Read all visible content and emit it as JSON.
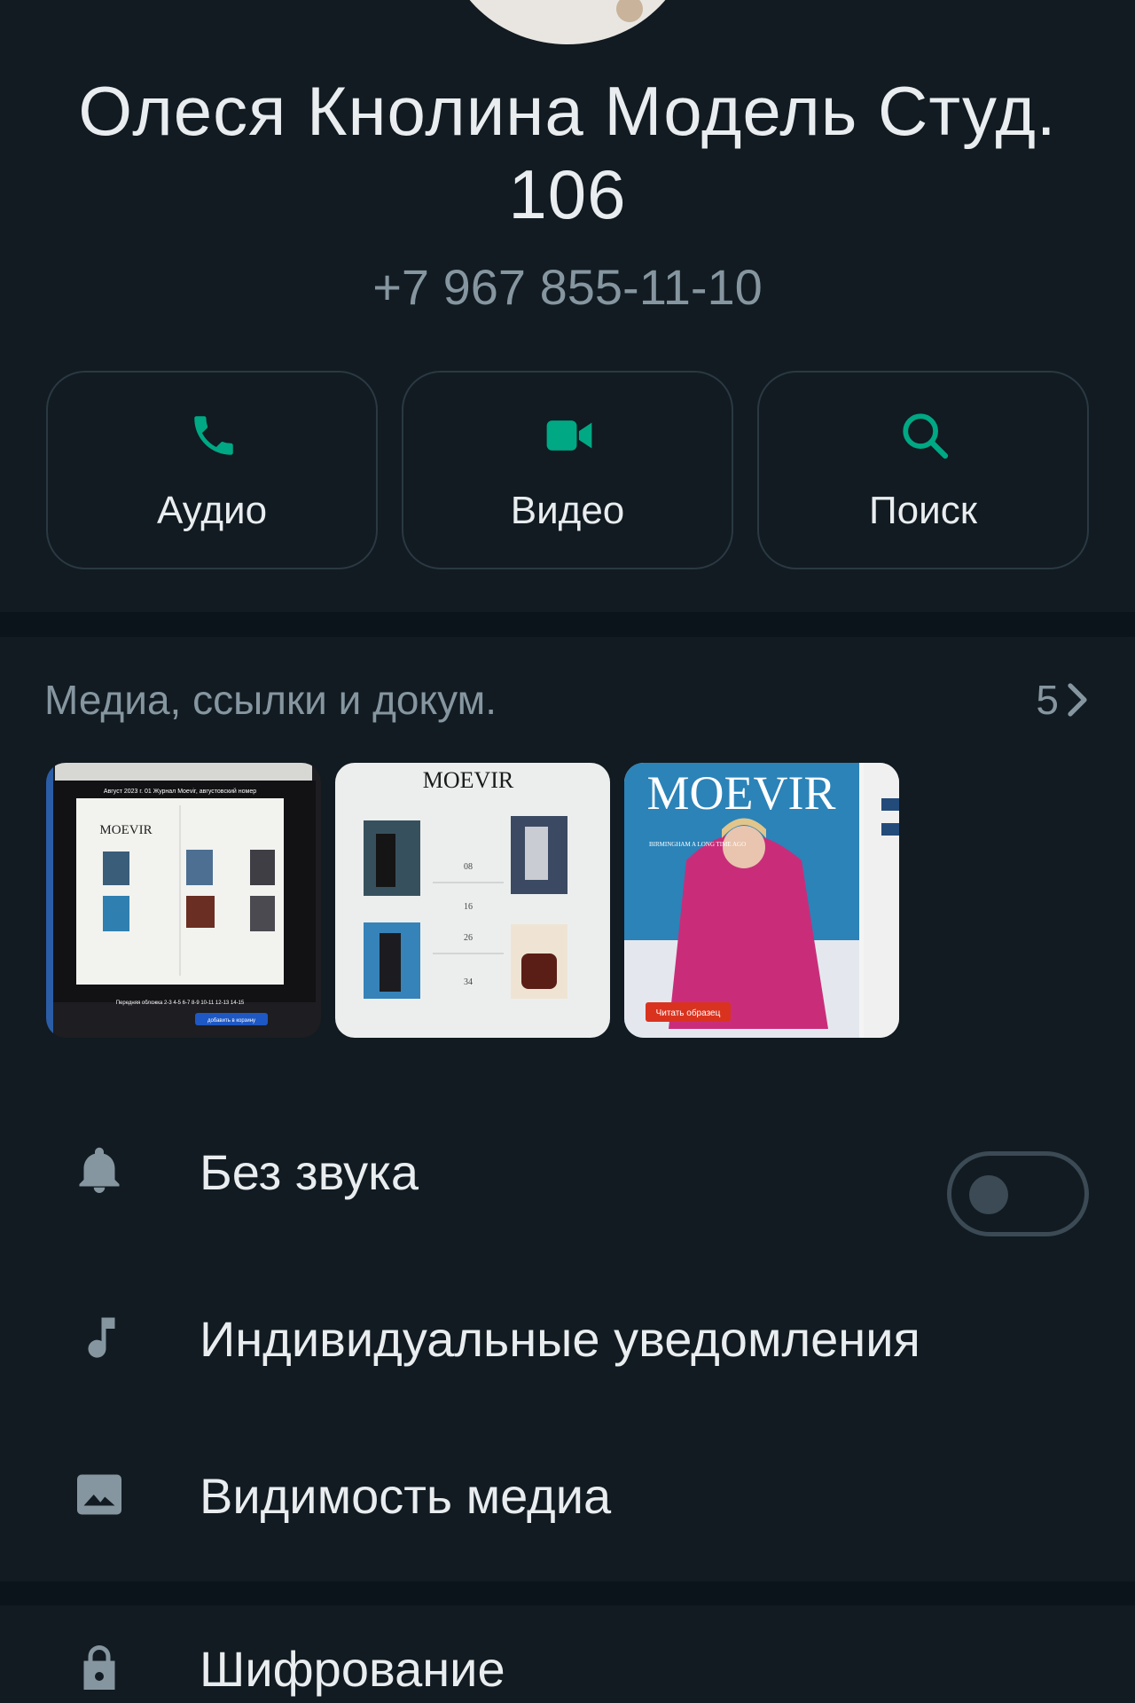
{
  "profile": {
    "name": "Олеся Кнолина Модель Студ. 106",
    "phone": "+7 967 855-11-10"
  },
  "actions": [
    {
      "label": "Аудио",
      "icon": "phone-icon"
    },
    {
      "label": "Видео",
      "icon": "video-icon"
    },
    {
      "label": "Поиск",
      "icon": "search-icon"
    }
  ],
  "media": {
    "title": "Медиа, ссылки и докум.",
    "count": "5",
    "thumbnails": [
      {
        "brand": "MOEVIR",
        "caption": "Август 2023 г.  01 Журнал Moevir, августовский номер",
        "footer": "Передняя обложка  2-3  4-5  6-7  8-9  10-11  12-13  14-15",
        "button": "добавить в корзину"
      },
      {
        "brand": "MOEVIR",
        "pages": [
          "08",
          "16",
          "26",
          "34"
        ]
      },
      {
        "brand": "MOEVIR",
        "badge": "Читать образец",
        "headline": "BIRMINGHAM A LONG TIME AGO"
      }
    ]
  },
  "settings": {
    "mute_label": "Без звука",
    "mute_on": false,
    "notifications_label": "Индивидуальные уведомления",
    "media_visibility_label": "Видимость медиа",
    "encryption_label": "Шифрование"
  },
  "colors": {
    "background": "#0b141a",
    "panel": "#111b21",
    "accent": "#00a884",
    "secondary_text": "#8696a0",
    "badge_red": "#d9331f"
  }
}
